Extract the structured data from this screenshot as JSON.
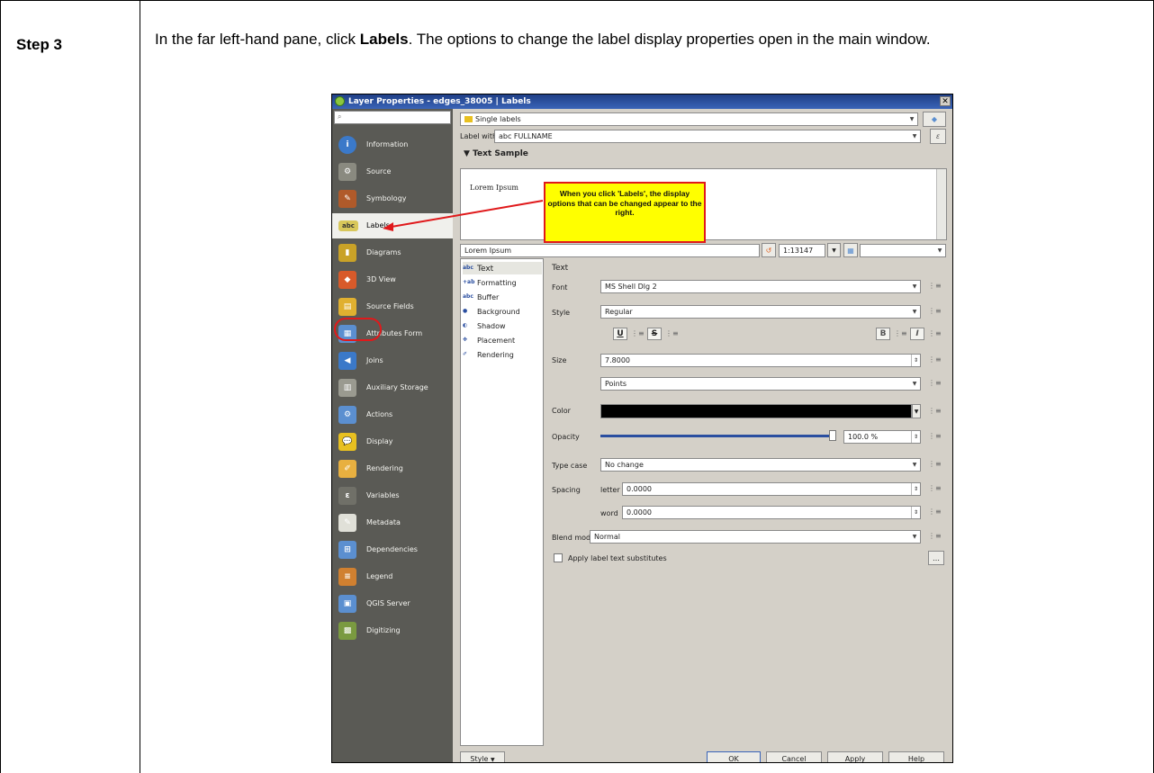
{
  "doc": {
    "step_label": "Step 3",
    "instruction_pre": "In the far left-hand pane, click ",
    "instruction_bold": "Labels",
    "instruction_post": ". The options to change the label display properties open in the main window."
  },
  "window": {
    "title": "Layer Properties - edges_38005 | Labels",
    "close_glyph": "✕"
  },
  "sidebar": {
    "search_glyph": "⌕",
    "items": [
      {
        "label": "Information",
        "icon": "information-icon",
        "glyph": "i",
        "color": "#3b79c9"
      },
      {
        "label": "Source",
        "icon": "source-icon",
        "glyph": "⚙",
        "color": "#8a8a80"
      },
      {
        "label": "Symbology",
        "icon": "symbology-icon",
        "glyph": "✎",
        "color": "#b05a2a"
      },
      {
        "label": "Labels",
        "icon": "labels-icon",
        "glyph": "abc",
        "color": "#d8c75a"
      },
      {
        "label": "Diagrams",
        "icon": "diagrams-icon",
        "glyph": "▮",
        "color": "#c9a227"
      },
      {
        "label": "3D View",
        "icon": "3d-view-icon",
        "glyph": "◆",
        "color": "#d85a2a"
      },
      {
        "label": "Source Fields",
        "icon": "source-fields-icon",
        "glyph": "▤",
        "color": "#e0b030"
      },
      {
        "label": "Attributes Form",
        "icon": "attributes-form-icon",
        "glyph": "▦",
        "color": "#5b8fd0"
      },
      {
        "label": "Joins",
        "icon": "joins-icon",
        "glyph": "◀",
        "color": "#3b79c9"
      },
      {
        "label": "Auxiliary Storage",
        "icon": "auxiliary-storage-icon",
        "glyph": "▥",
        "color": "#9a9a90"
      },
      {
        "label": "Actions",
        "icon": "actions-icon",
        "glyph": "⚙",
        "color": "#5b8fd0"
      },
      {
        "label": "Display",
        "icon": "display-icon",
        "glyph": "💬",
        "color": "#e8c020"
      },
      {
        "label": "Rendering",
        "icon": "rendering-icon",
        "glyph": "✐",
        "color": "#e8b040"
      },
      {
        "label": "Variables",
        "icon": "variables-icon",
        "glyph": "ε",
        "color": "#707068"
      },
      {
        "label": "Metadata",
        "icon": "metadata-icon",
        "glyph": "✎",
        "color": "#e0e0d8"
      },
      {
        "label": "Dependencies",
        "icon": "dependencies-icon",
        "glyph": "⊞",
        "color": "#5b8fd0"
      },
      {
        "label": "Legend",
        "icon": "legend-icon",
        "glyph": "≡",
        "color": "#d08030"
      },
      {
        "label": "QGIS Server",
        "icon": "qgis-server-icon",
        "glyph": "▣",
        "color": "#5b8fd0"
      },
      {
        "label": "Digitizing",
        "icon": "digitizing-icon",
        "glyph": "▩",
        "color": "#7a9a40"
      }
    ]
  },
  "main": {
    "mode_value": "Single labels",
    "label_with_label": "Label with",
    "label_with_value": "abc FULLNAME",
    "expression_glyph": "ε",
    "text_sample_header": "Text Sample",
    "sample_text": "Lorem Ipsum",
    "sample_input_value": "Lorem Ipsum",
    "scale_value": "1:13147",
    "callout_text": "When you click 'Labels', the display options that can be changed appear to the right.",
    "tabs": [
      {
        "label": "Text",
        "glyph": "abc"
      },
      {
        "label": "Formatting",
        "glyph": "+ab"
      },
      {
        "label": "Buffer",
        "glyph": "abc"
      },
      {
        "label": "Background",
        "glyph": "●"
      },
      {
        "label": "Shadow",
        "glyph": "◐"
      },
      {
        "label": "Placement",
        "glyph": "✥"
      },
      {
        "label": "Rendering",
        "glyph": "✐"
      }
    ],
    "section_title": "Text",
    "font_label": "Font",
    "font_value": "MS Shell Dlg 2",
    "style_label": "Style",
    "style_value": "Regular",
    "underline": "U",
    "strike": "S",
    "bold": "B",
    "italic": "I",
    "size_label": "Size",
    "size_value": "7.8000",
    "size_unit": "Points",
    "color_label": "Color",
    "color_value": "#000000",
    "opacity_label": "Opacity",
    "opacity_value": "100.0 %",
    "opacity_fraction": 1.0,
    "type_case_label": "Type case",
    "type_case_value": "No change",
    "spacing_label": "Spacing",
    "letter_label": "letter",
    "letter_value": "0.0000",
    "word_label": "word",
    "word_value": "0.0000",
    "blend_mode_label": "Blend mode",
    "blend_mode_value": "Normal",
    "substitutes_label": "Apply label text substitutes",
    "more_glyph": "…"
  },
  "footer": {
    "style_btn": "Style",
    "ok": "OK",
    "cancel": "Cancel",
    "apply": "Apply",
    "help": "Help"
  }
}
